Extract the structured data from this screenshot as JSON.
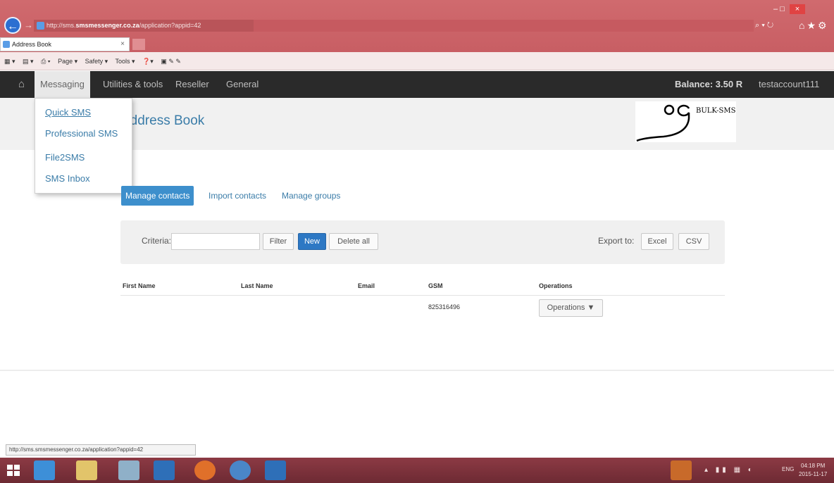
{
  "browser": {
    "address": {
      "prefix": "http://sms.",
      "host": "smsmessenger.co.za",
      "path": "/application?appid=42"
    },
    "tab_title": "Address Book",
    "tab_close": "×",
    "commands": [
      "Page ▾",
      "Safety ▾",
      "Tools ▾"
    ],
    "status_url": "http://sms.smsmessenger.co.za/application?appid=42"
  },
  "navbar": {
    "items": [
      "Messaging",
      "Utilities & tools",
      "Reseller",
      "General"
    ],
    "balance": "Balance: 3.50 R",
    "user": "testaccount111"
  },
  "dropdown": {
    "items": [
      "Quick SMS",
      "Professional SMS",
      "File2SMS",
      "SMS Inbox"
    ]
  },
  "page": {
    "title": "Address Book"
  },
  "logo": {
    "text": "BULK-SMS"
  },
  "tabs": [
    "Manage contacts",
    "Import contacts",
    "Manage groups"
  ],
  "filter": {
    "criteria_label": "Criteria:",
    "criteria_value": "",
    "filter_button": "Filter",
    "new_button": "New",
    "delete_all_button": "Delete all",
    "export_label": "Export to:",
    "excel_button": "Excel",
    "csv_button": "CSV"
  },
  "table": {
    "headers": [
      "First Name",
      "Last Name",
      "Email",
      "GSM",
      "Operations"
    ],
    "rows": [
      {
        "first_name": "",
        "last_name": "",
        "email": "",
        "gsm": "825316496",
        "operations": "Operations ▼"
      }
    ]
  },
  "taskbar": {
    "lang": "ENG",
    "time": "04:18 PM",
    "date": "2015-11-17"
  },
  "colors": {
    "chrome": "#c55a60",
    "navbar": "#2a2a2a",
    "link": "#3a7ca8",
    "primary": "#2d78c4",
    "taskbar": "#7a2f39"
  }
}
